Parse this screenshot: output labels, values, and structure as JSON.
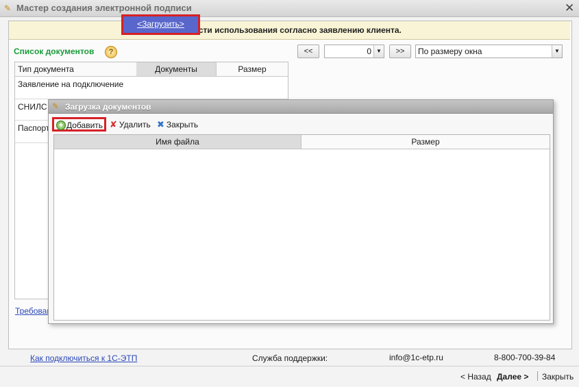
{
  "window": {
    "title": "Мастер создания электронной подписи",
    "close_glyph": "✕"
  },
  "banner": {
    "text": "Области использования согласно заявлению клиента."
  },
  "doc_list": {
    "title": "Список документов",
    "help_glyph": "?"
  },
  "pager": {
    "prev_label": "<<",
    "page_value": "0",
    "next_label": ">>",
    "scale_value": "По размеру окна",
    "dropdown_glyph": "▼"
  },
  "doc_table": {
    "columns": [
      "Тип документа",
      "Документы",
      "Размер"
    ],
    "rows": [
      {
        "type": "Заявление на подключение",
        "documents": "<Загрузить>",
        "size": ""
      },
      {
        "type": "СНИЛС",
        "documents": "",
        "size": ""
      },
      {
        "type": "Паспорт",
        "documents": "",
        "size": ""
      }
    ]
  },
  "requirements_link": "Требован",
  "popup": {
    "title": "Загрузка документов",
    "toolbar": {
      "add_label": "Добавить",
      "delete_label": "Удалить",
      "close_label": "Закрыть",
      "add_icon": "+",
      "delete_icon": "✘",
      "close_icon": "✖"
    },
    "file_table": {
      "columns": [
        "Имя файла",
        "Размер"
      ]
    }
  },
  "footer": {
    "how_to_link": "Как подключиться к 1С-ЭТП",
    "support_label": "Служба поддержки:",
    "support_email": "info@1c-etp.ru",
    "support_phone": "8-800-700-39-84"
  },
  "nav": {
    "back_label": "< Назад",
    "next_label": "Далее  >",
    "close_label": "Закрыть"
  },
  "colors": {
    "accent_green": "#1a9b3a",
    "link_blue": "#2a47b8",
    "highlight_red": "#d72026",
    "selected_cell": "#5967cc",
    "banner_bg": "#f8f4d5"
  }
}
